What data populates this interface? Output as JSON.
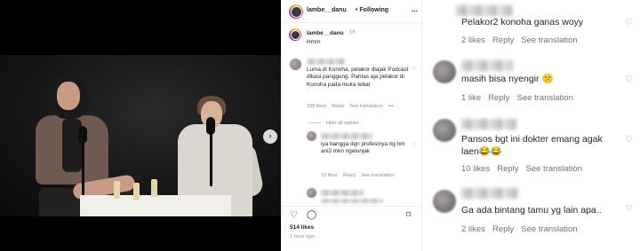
{
  "header": {
    "username": "lambe__danu",
    "separator": "•",
    "follow_label": "Following",
    "more_icon": "..."
  },
  "caption": {
    "username": "lambe__danu",
    "time": "1h",
    "text": "Hmm"
  },
  "video": {
    "next_icon": "chevron-right",
    "wall_text": ""
  },
  "comments": [
    {
      "text": "Luma di Konoha, pelakor diajak Podcast dikasi panggung. Pantas aja pelakor di Konoha pada muka tebal",
      "likes": "338 likes",
      "reply": "Reply",
      "translate": "See translation",
      "more": "•••"
    },
    {
      "hide_replies": "Hide all replies",
      "text": "iya bangga dgn profesinya ng hm ani2 mkn ngelunjak",
      "likes": "10 likes",
      "reply": "Reply",
      "translate": "See translation"
    }
  ],
  "actions": {
    "likes": "514 likes",
    "time_ago": "1 hour ago",
    "heart_icon": "heart",
    "comment_icon": "comment",
    "share_icon": "send",
    "save_icon": "bookmark"
  },
  "zoom_comments": [
    {
      "text": "Pelakor2 konoha ganas woyy",
      "likes": "2 likes",
      "reply": "Reply",
      "translate": "See translation"
    },
    {
      "text": "masih bisa nyengir 😕",
      "likes": "1 like",
      "reply": "Reply",
      "translate": "See translation"
    },
    {
      "text": "Pansos bgt ini dokter emang agak laen😂😂",
      "likes": "10 likes",
      "reply": "Reply",
      "translate": "See translation"
    },
    {
      "text": "Ga ada bintang tamu yg lain apa..",
      "likes": "2 likes",
      "reply": "Reply",
      "translate": "See translation"
    }
  ]
}
